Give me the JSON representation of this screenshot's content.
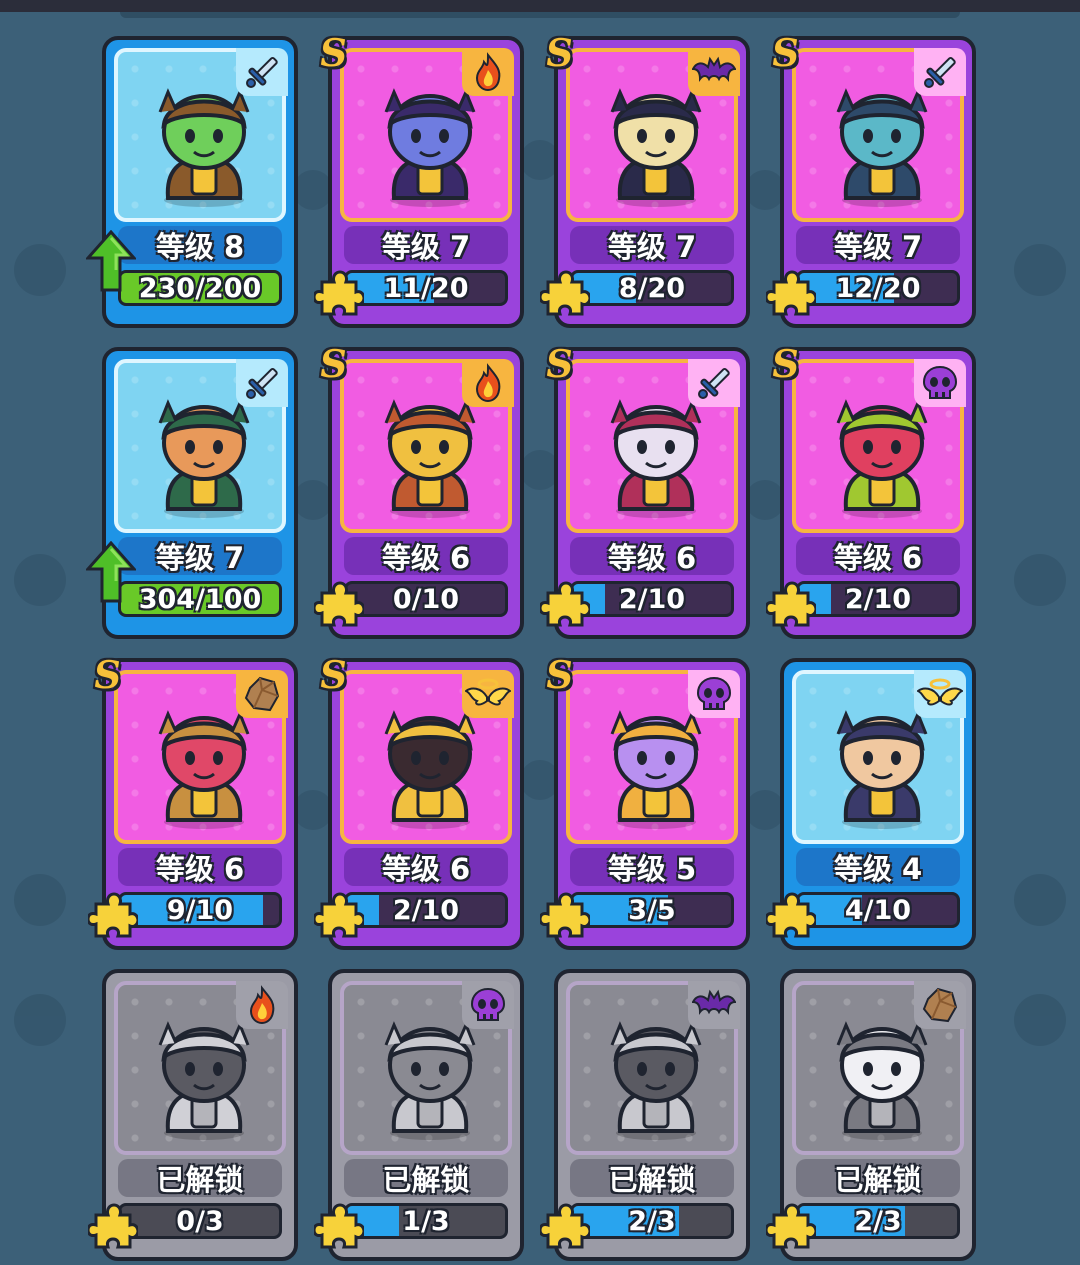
{
  "cards": [
    {
      "tier": "blue",
      "s": false,
      "element": "sword",
      "level": "等级 8",
      "progress": "230/200",
      "fill": 1.0,
      "upgradable": true,
      "character": "beast-warrior",
      "colors": [
        "#6fcf5b",
        "#8a5a2b"
      ]
    },
    {
      "tier": "purple",
      "s": true,
      "element": "fire",
      "level": "等级 7",
      "progress": "11/20",
      "fill": 0.55,
      "upgradable": false,
      "character": "demon-lord",
      "colors": [
        "#6f7ce0",
        "#3a2a6a"
      ]
    },
    {
      "tier": "purple",
      "s": true,
      "element": "bat",
      "level": "等级 7",
      "progress": "8/20",
      "fill": 0.4,
      "upgradable": false,
      "character": "jester",
      "colors": [
        "#f0e0a8",
        "#2a2a4a"
      ]
    },
    {
      "tier": "purple",
      "s": true,
      "element": "sword",
      "level": "等级 7",
      "progress": "12/20",
      "fill": 0.6,
      "upgradable": false,
      "character": "armored-knight",
      "colors": [
        "#5bb8c8",
        "#2e4a6a"
      ]
    },
    {
      "tier": "blue",
      "s": false,
      "element": "sword",
      "level": "等级 7",
      "progress": "304/100",
      "fill": 1.0,
      "upgradable": true,
      "character": "tribal-monkey",
      "colors": [
        "#e8995a",
        "#2e6a4a"
      ]
    },
    {
      "tier": "purple",
      "s": true,
      "element": "fire",
      "level": "等级 6",
      "progress": "0/10",
      "fill": 0.0,
      "upgradable": false,
      "character": "golden-priestess",
      "colors": [
        "#f0c040",
        "#c05a30"
      ]
    },
    {
      "tier": "purple",
      "s": true,
      "element": "sword",
      "level": "等级 6",
      "progress": "2/10",
      "fill": 0.2,
      "upgradable": false,
      "character": "red-hood-archer",
      "colors": [
        "#e8e0f0",
        "#b0305a"
      ]
    },
    {
      "tier": "purple",
      "s": true,
      "element": "skull",
      "level": "等级 6",
      "progress": "2/10",
      "fill": 0.2,
      "upgradable": false,
      "character": "flower-plant",
      "colors": [
        "#e04060",
        "#a0c830"
      ]
    },
    {
      "tier": "purple",
      "s": true,
      "element": "rock",
      "level": "等级 6",
      "progress": "9/10",
      "fill": 0.9,
      "upgradable": false,
      "character": "crystal-spider",
      "colors": [
        "#e04868",
        "#c89040"
      ]
    },
    {
      "tier": "purple",
      "s": true,
      "element": "wings",
      "level": "等级 6",
      "progress": "2/10",
      "fill": 0.2,
      "upgradable": false,
      "character": "hooded-mage",
      "colors": [
        "#3a2a30",
        "#f0c040"
      ]
    },
    {
      "tier": "purple",
      "s": true,
      "element": "skull",
      "level": "等级 5",
      "progress": "3/5",
      "fill": 0.6,
      "upgradable": false,
      "character": "blonde-girl",
      "colors": [
        "#b890f0",
        "#f0b040"
      ]
    },
    {
      "tier": "blue",
      "s": false,
      "element": "wings",
      "level": "等级 4",
      "progress": "4/10",
      "fill": 0.4,
      "upgradable": false,
      "character": "bearded-king",
      "colors": [
        "#f0c8a0",
        "#3a3a6a"
      ]
    },
    {
      "tier": "gray",
      "s": false,
      "element": "fire",
      "level": "已解锁",
      "progress": "0/3",
      "fill": 0.0,
      "upgradable": false,
      "character": "egg-dragon",
      "colors": [
        "#5a5a62",
        "#d0d0d6"
      ]
    },
    {
      "tier": "gray",
      "s": false,
      "element": "skull",
      "level": "已解锁",
      "progress": "1/3",
      "fill": 0.33,
      "upgradable": false,
      "character": "egg-golem",
      "colors": [
        "#8a8a92",
        "#c8c8ce"
      ]
    },
    {
      "tier": "gray",
      "s": false,
      "element": "bat",
      "level": "已解锁",
      "progress": "2/3",
      "fill": 0.67,
      "upgradable": false,
      "character": "bandana-rogue",
      "colors": [
        "#5a5a62",
        "#c8c8ce"
      ]
    },
    {
      "tier": "gray",
      "s": false,
      "element": "rock",
      "level": "已解锁",
      "progress": "2/3",
      "fill": 0.67,
      "upgradable": false,
      "character": "horned-helmet",
      "colors": [
        "#f0f0f4",
        "#7a7a82"
      ]
    }
  ],
  "s_label": "S"
}
